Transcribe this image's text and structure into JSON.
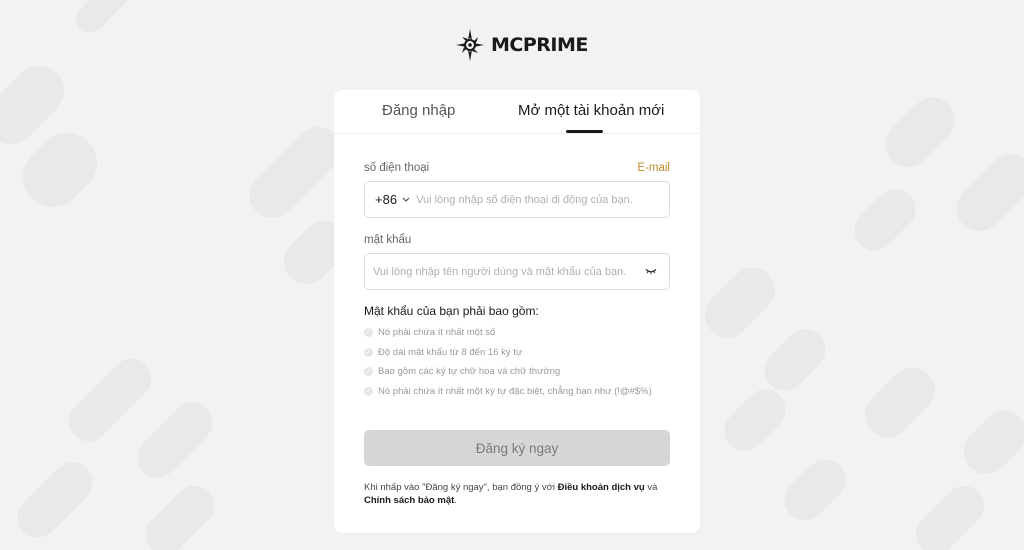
{
  "brand": {
    "name": "MCPRIME"
  },
  "tabs": {
    "login": "Đăng nhập",
    "register": "Mở một tài khoản mới",
    "active": "register"
  },
  "phone": {
    "label": "số điện thoại",
    "switch_link": "E-mail",
    "country_code": "+86",
    "placeholder": "Vui lòng nhập số điện thoại di động của bạn."
  },
  "password": {
    "label": "mật khẩu",
    "placeholder": "Vui lòng nhập tên người dùng và mật khẩu của bạn."
  },
  "requirements": {
    "title": "Mật khẩu của bạn phải bao gồm:",
    "items": [
      "Nó phải chứa ít nhất một số",
      "Độ dài mật khẩu từ 8 đến 16 ký tự",
      "Bao gồm các ký tự chữ hoa và chữ thường",
      "Nó phải chứa ít nhất một ký tự đặc biệt, chẳng hạn như (!@#$%)"
    ]
  },
  "submit_label": "Đăng ký ngay",
  "terms": {
    "prefix": "Khi nhấp vào \"Đăng ký ngay\", bạn đồng ý với ",
    "service_link": "Điều khoản dịch vụ",
    "and": " và ",
    "privacy_link": "Chính sách bảo mật",
    "suffix": "."
  },
  "colors": {
    "background": "#f2f2f2",
    "accent_link": "#c08a2d",
    "button_disabled": "#d6d6d6",
    "text_dark": "#1a1a1a"
  },
  "icons": {
    "logo": "compass-star-logo-icon",
    "country_dropdown": "chevron-down-icon",
    "password_visibility": "eye-closed-icon",
    "requirement": "check-circle-icon"
  }
}
